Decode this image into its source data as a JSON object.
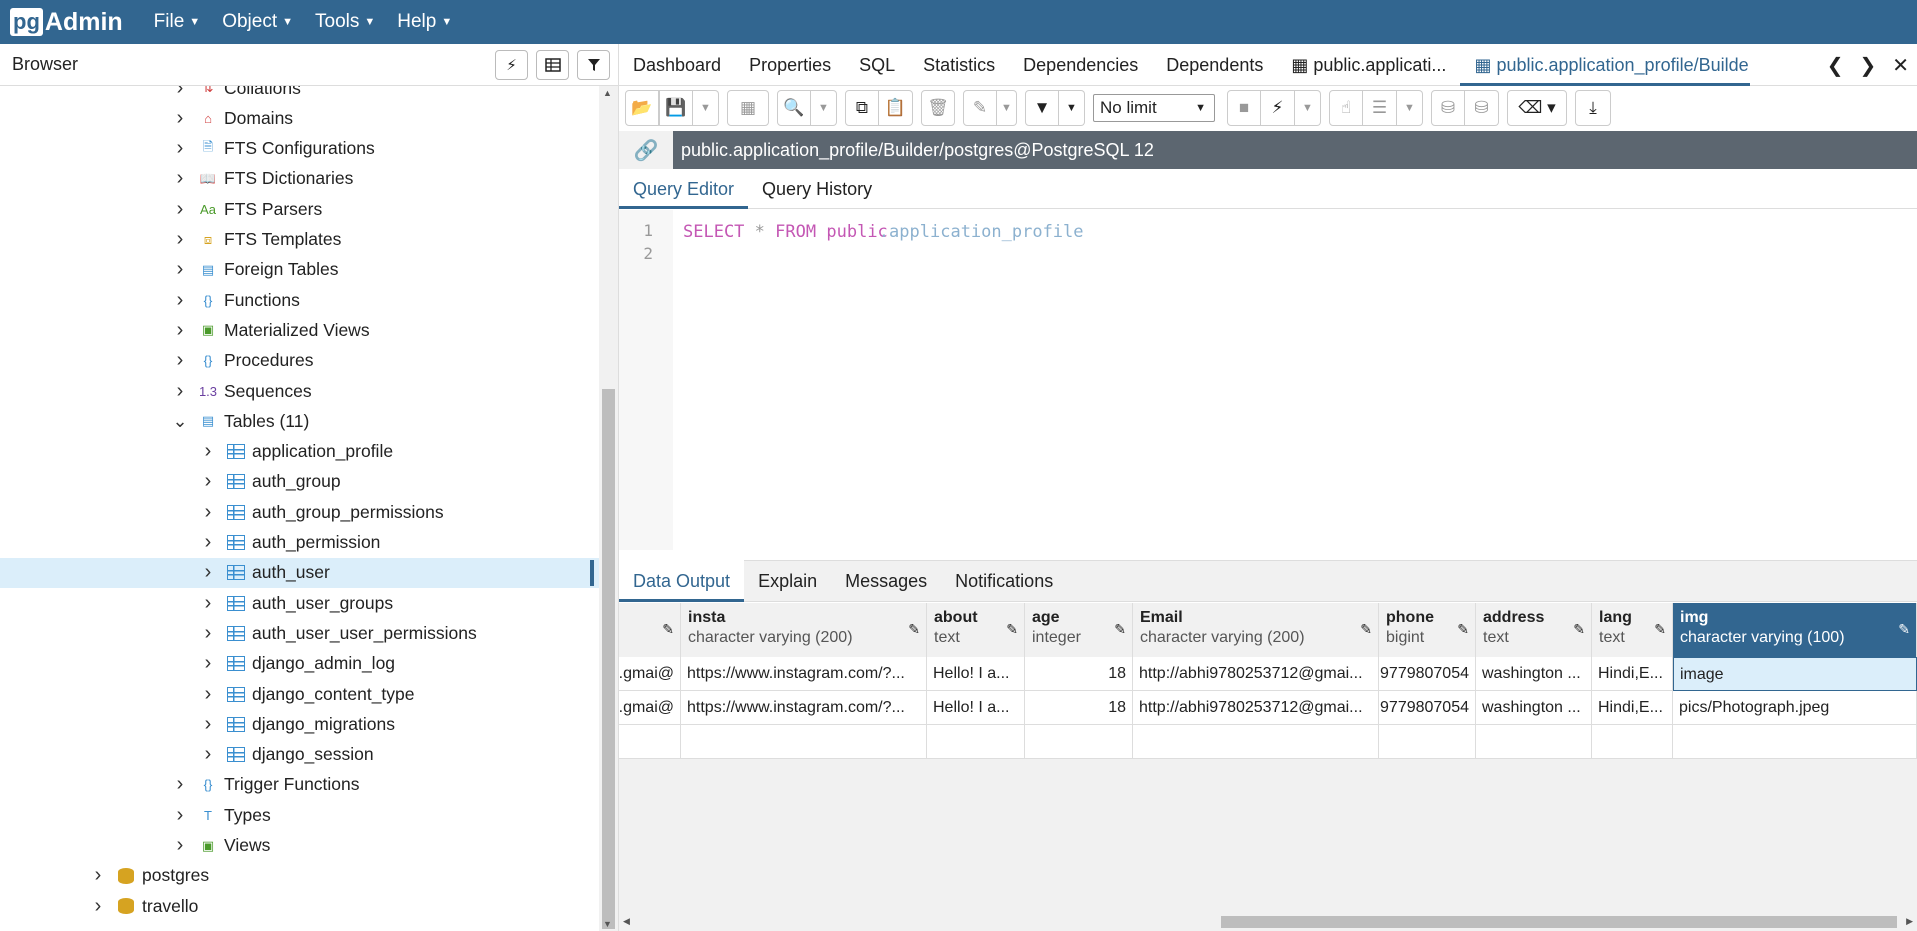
{
  "app": {
    "logo_pg": "pg",
    "logo_admin": "Admin"
  },
  "menu": [
    "File",
    "Object",
    "Tools",
    "Help"
  ],
  "browser": {
    "title": "Browser"
  },
  "tree": [
    {
      "label": "Collations",
      "icon": "collation-icon",
      "depth": 1,
      "expanded": false
    },
    {
      "label": "Domains",
      "icon": "domain-icon",
      "depth": 1,
      "expanded": false
    },
    {
      "label": "FTS Configurations",
      "icon": "fts-config-icon",
      "depth": 1,
      "expanded": false
    },
    {
      "label": "FTS Dictionaries",
      "icon": "fts-dictionary-icon",
      "depth": 1,
      "expanded": false
    },
    {
      "label": "FTS Parsers",
      "icon": "fts-parser-icon",
      "depth": 1,
      "expanded": false
    },
    {
      "label": "FTS Templates",
      "icon": "fts-template-icon",
      "depth": 1,
      "expanded": false
    },
    {
      "label": "Foreign Tables",
      "icon": "foreign-table-icon",
      "depth": 1,
      "expanded": false
    },
    {
      "label": "Functions",
      "icon": "function-icon",
      "depth": 1,
      "expanded": false
    },
    {
      "label": "Materialized Views",
      "icon": "materialized-view-icon",
      "depth": 1,
      "expanded": false
    },
    {
      "label": "Procedures",
      "icon": "procedure-icon",
      "depth": 1,
      "expanded": false
    },
    {
      "label": "Sequences",
      "icon": "sequence-icon",
      "depth": 1,
      "expanded": false
    },
    {
      "label": "Tables (11)",
      "icon": "tables-icon",
      "depth": 1,
      "expanded": true
    },
    {
      "label": "application_profile",
      "icon": "table-icon",
      "depth": 2,
      "expanded": false
    },
    {
      "label": "auth_group",
      "icon": "table-icon",
      "depth": 2,
      "expanded": false
    },
    {
      "label": "auth_group_permissions",
      "icon": "table-icon",
      "depth": 2,
      "expanded": false
    },
    {
      "label": "auth_permission",
      "icon": "table-icon",
      "depth": 2,
      "expanded": false
    },
    {
      "label": "auth_user",
      "icon": "table-icon",
      "depth": 2,
      "expanded": false,
      "selected": true
    },
    {
      "label": "auth_user_groups",
      "icon": "table-icon",
      "depth": 2,
      "expanded": false
    },
    {
      "label": "auth_user_user_permissions",
      "icon": "table-icon",
      "depth": 2,
      "expanded": false
    },
    {
      "label": "django_admin_log",
      "icon": "table-icon",
      "depth": 2,
      "expanded": false
    },
    {
      "label": "django_content_type",
      "icon": "table-icon",
      "depth": 2,
      "expanded": false
    },
    {
      "label": "django_migrations",
      "icon": "table-icon",
      "depth": 2,
      "expanded": false
    },
    {
      "label": "django_session",
      "icon": "table-icon",
      "depth": 2,
      "expanded": false
    },
    {
      "label": "Trigger Functions",
      "icon": "trigger-function-icon",
      "depth": 1,
      "expanded": false
    },
    {
      "label": "Types",
      "icon": "type-icon",
      "depth": 1,
      "expanded": false
    },
    {
      "label": "Views",
      "icon": "view-icon",
      "depth": 1,
      "expanded": false
    },
    {
      "label": "postgres",
      "icon": "database-icon",
      "depth": 0,
      "expanded": false
    },
    {
      "label": "travello",
      "icon": "database-icon",
      "depth": 0,
      "expanded": false
    }
  ],
  "tabs": [
    {
      "label": "Dashboard"
    },
    {
      "label": "Properties"
    },
    {
      "label": "SQL"
    },
    {
      "label": "Statistics"
    },
    {
      "label": "Dependencies"
    },
    {
      "label": "Dependents"
    },
    {
      "label": "public.applicati..."
    },
    {
      "label": "public.application_profile/Builde",
      "active": true
    }
  ],
  "toolbar": {
    "limit": "No limit"
  },
  "connection": {
    "text": "public.application_profile/Builder/postgres@PostgreSQL 12"
  },
  "query_tabs": [
    {
      "label": "Query Editor",
      "active": true
    },
    {
      "label": "Query History"
    }
  ],
  "editor": {
    "line_numbers": [
      "1",
      "2"
    ],
    "kw1": "SELECT",
    "star": "*",
    "kw2": "FROM",
    "schema": "public",
    "dot": ".",
    "table": "application_profile"
  },
  "output_tabs": [
    {
      "label": "Data Output",
      "active": true
    },
    {
      "label": "Explain"
    },
    {
      "label": "Messages"
    },
    {
      "label": "Notifications"
    }
  ],
  "columns": [
    {
      "name": "",
      "type": ""
    },
    {
      "name": "insta",
      "type": "character varying (200)"
    },
    {
      "name": "about",
      "type": "text"
    },
    {
      "name": "age",
      "type": "integer"
    },
    {
      "name": "Email",
      "type": "character varying (200)"
    },
    {
      "name": "phone",
      "type": "bigint"
    },
    {
      "name": "address",
      "type": "text"
    },
    {
      "name": "lang",
      "type": "text"
    },
    {
      "name": "img",
      "type": "character varying (100)",
      "selected": true
    }
  ],
  "rows": [
    [
      "@gmai...",
      "https://www.instagram.com/?...",
      "Hello! I a...",
      "18",
      "http://abhi9780253712@gmai...",
      "9779807054",
      "washington ...",
      "Hindi,E...",
      "image"
    ],
    [
      "@gmai...",
      "https://www.instagram.com/?...",
      "Hello! I a...",
      "18",
      "http://abhi9780253712@gmai...",
      "9779807054",
      "washington ...",
      "Hindi,E...",
      "pics/Photograph.jpeg"
    ]
  ]
}
